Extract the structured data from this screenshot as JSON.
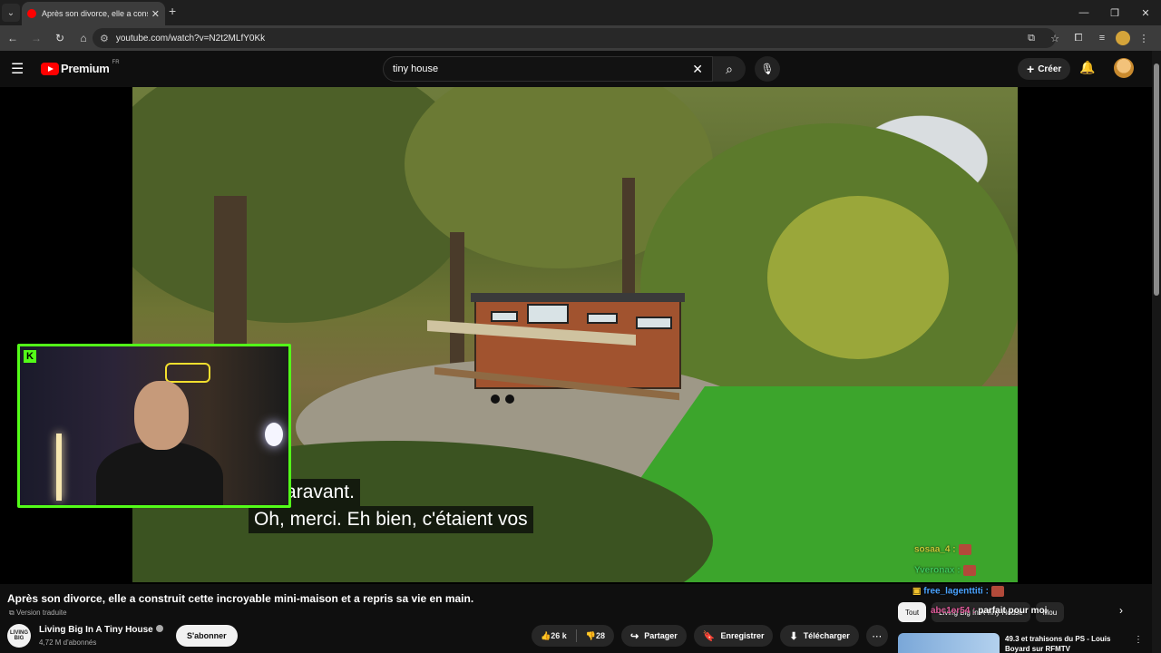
{
  "browser": {
    "tab_title": "Après son divorce, elle a construit",
    "url": "youtube.com/watch?v=N2t2MLfY0Kk",
    "new_tab_label": "+"
  },
  "header": {
    "logo_text": "Premium",
    "region": "FR",
    "search_value": "tiny house",
    "create_label": "Créer"
  },
  "video": {
    "subtitle_line1": "auparavant.",
    "subtitle_line2": "Oh, merci.  Eh bien, c'étaient vos",
    "title": "Après son divorce, elle a construit cette incroyable mini-maison et a repris sa vie en main.",
    "translated_label": "Version traduite"
  },
  "chat": [
    {
      "user": "sosaa_4",
      "sep": " :",
      "color": "#c8c838"
    },
    {
      "user": "Yveronax",
      "sep": " :",
      "color": "#3ec95c"
    },
    {
      "user": "free_lagenttiti",
      "sep": " :",
      "color": "#4aa3ff"
    },
    {
      "user": "abc1er54",
      "sep": " : ",
      "message": "parfait pour moi",
      "color": "#e05a9a"
    }
  ],
  "channel": {
    "name": "Living Big In A Tiny House",
    "subscribers": "4,72 M d'abonnés",
    "avatar_text": "LIVING BIG",
    "subscribe_label": "S'abonner"
  },
  "actions": {
    "likes": "26 k",
    "dislikes": "28",
    "share": "Partager",
    "save": "Enregistrer",
    "download": "Télécharger"
  },
  "sidebar": {
    "chips": [
      "Tout",
      "Living Big In A Tiny House",
      "Mou"
    ],
    "recommended_title": "49.3 et trahisons du PS - Louis Boyard sur RFMTV"
  },
  "colors": {
    "accent_red": "#ff0000",
    "kick_green": "#53fc18",
    "background": "#0f0f0f"
  }
}
